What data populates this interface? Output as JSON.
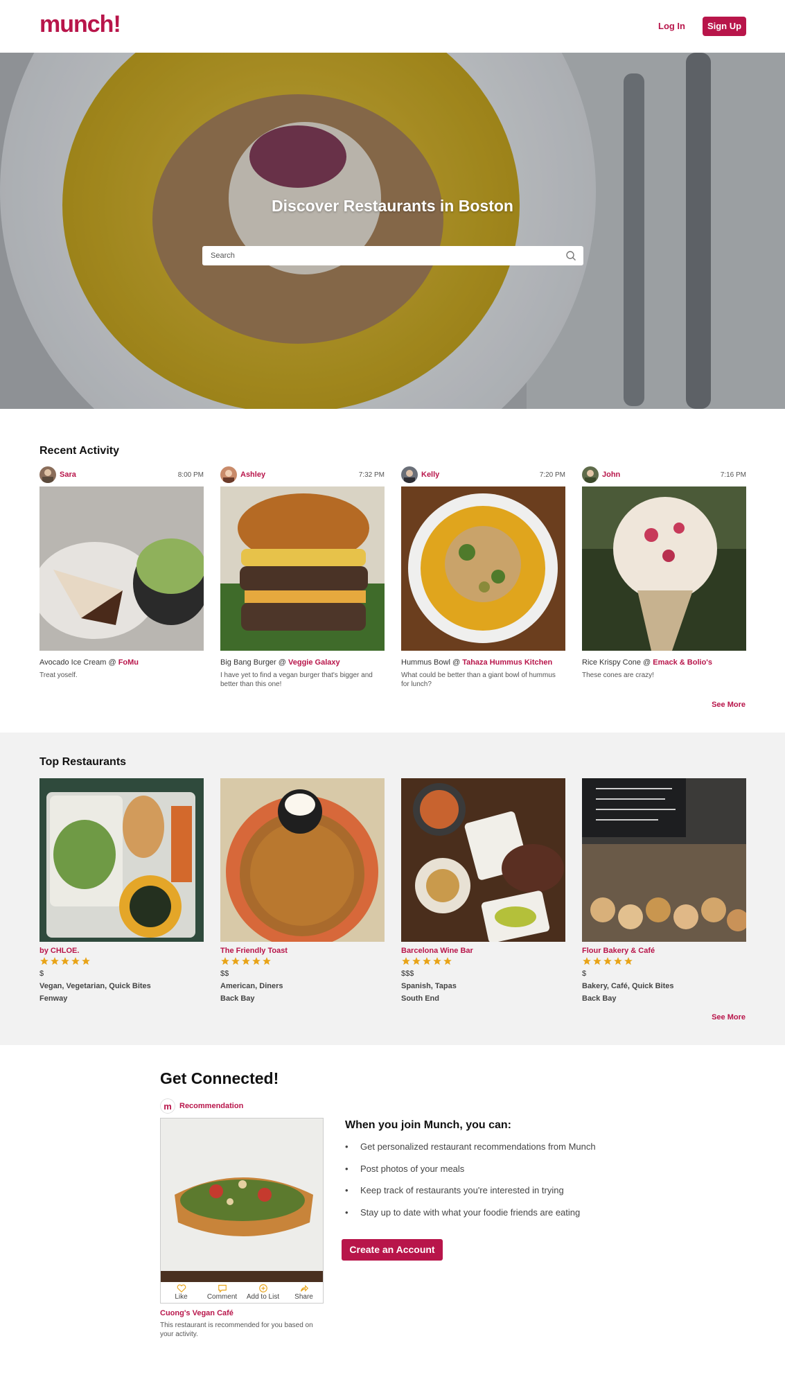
{
  "header": {
    "logo": "munch!",
    "login_label": "Log In",
    "signup_label": "Sign Up"
  },
  "hero": {
    "title": "Discover Restaurants in Boston",
    "search_placeholder": "Search"
  },
  "recent": {
    "title": "Recent Activity",
    "items": [
      {
        "user": "Sara",
        "time": "8:00 PM",
        "dish": "Avocado Ice Cream @ ",
        "place": "FoMu",
        "desc": "Treat yoself."
      },
      {
        "user": "Ashley",
        "time": "7:32 PM",
        "dish": "Big Bang Burger @ ",
        "place": "Veggie Galaxy",
        "desc": "I have yet to find a vegan burger that's bigger and better than this one!"
      },
      {
        "user": "Kelly",
        "time": "7:20 PM",
        "dish": "Hummus Bowl @ ",
        "place": "Tahaza Hummus Kitchen",
        "desc": "What could be better than a giant bowl of hummus for lunch?"
      },
      {
        "user": "John",
        "time": "7:16 PM",
        "dish": "Rice Krispy Cone @ ",
        "place": "Emack & Bolio's",
        "desc": "These cones are crazy!"
      }
    ],
    "see_more": "See More"
  },
  "top": {
    "title": "Top Restaurants",
    "items": [
      {
        "name": "by CHLOE.",
        "rating": 5,
        "price": "$",
        "cats": "Vegan, Vegetarian, Quick Bites",
        "hood": "Fenway"
      },
      {
        "name": "The Friendly Toast",
        "rating": 5,
        "price": "$$",
        "cats": "American, Diners",
        "hood": "Back Bay"
      },
      {
        "name": "Barcelona Wine Bar",
        "rating": 5,
        "price": "$$$",
        "cats": "Spanish, Tapas",
        "hood": "South End"
      },
      {
        "name": "Flour Bakery & Café",
        "rating": 5,
        "price": "$",
        "cats": "Bakery, Café, Quick Bites",
        "hood": "Back Bay"
      }
    ],
    "see_more": "See More"
  },
  "connect": {
    "title": "Get Connected!",
    "rec_label": "Recommendation",
    "rec_actions": [
      "Like",
      "Comment",
      "Add to List",
      "Share"
    ],
    "rec_name": "Cuong's Vegan Café",
    "rec_desc": "This restaurant is recommended for you based on your activity.",
    "join_title": "When you join Munch, you can:",
    "benefits": [
      "Get personalized restaurant recommendations from Munch",
      "Post photos of your meals",
      "Keep track of restaurants you're interested in trying",
      "Stay up to date with what your foodie friends are eating"
    ],
    "cta": "Create an Account"
  },
  "colors": {
    "accent": "#b8154a",
    "star": "#e8a317",
    "band": "#f2f2f2"
  }
}
